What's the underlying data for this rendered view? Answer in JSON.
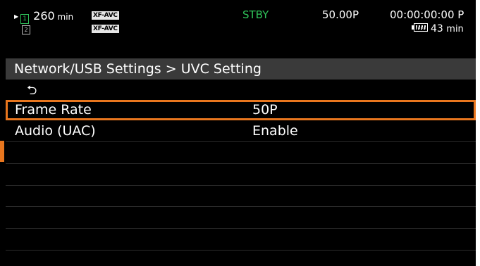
{
  "status": {
    "slot1_play_glyph": "▶",
    "slot1_card_num": "1",
    "slot1_remaining": "260",
    "slot1_unit": "min",
    "slot2_card_num": "2",
    "slot2_icon": "no-card-icon",
    "format1": "XF-AVC",
    "format2": "XF-AVC",
    "mode": "STBY",
    "frame_rate": "50.00P",
    "timecode": "00:00:00:00 P",
    "battery_remaining": "43",
    "battery_unit": "min",
    "accent_color": "#2fc45a"
  },
  "menu": {
    "title": "Network/USB Settings > UVC Setting",
    "back_glyph": "⮌",
    "items": [
      {
        "label": "Frame Rate",
        "value": "50P",
        "selected": true
      },
      {
        "label": "Audio (UAC)",
        "value": "Enable",
        "selected": false
      }
    ],
    "highlight_color": "#e8761e"
  }
}
